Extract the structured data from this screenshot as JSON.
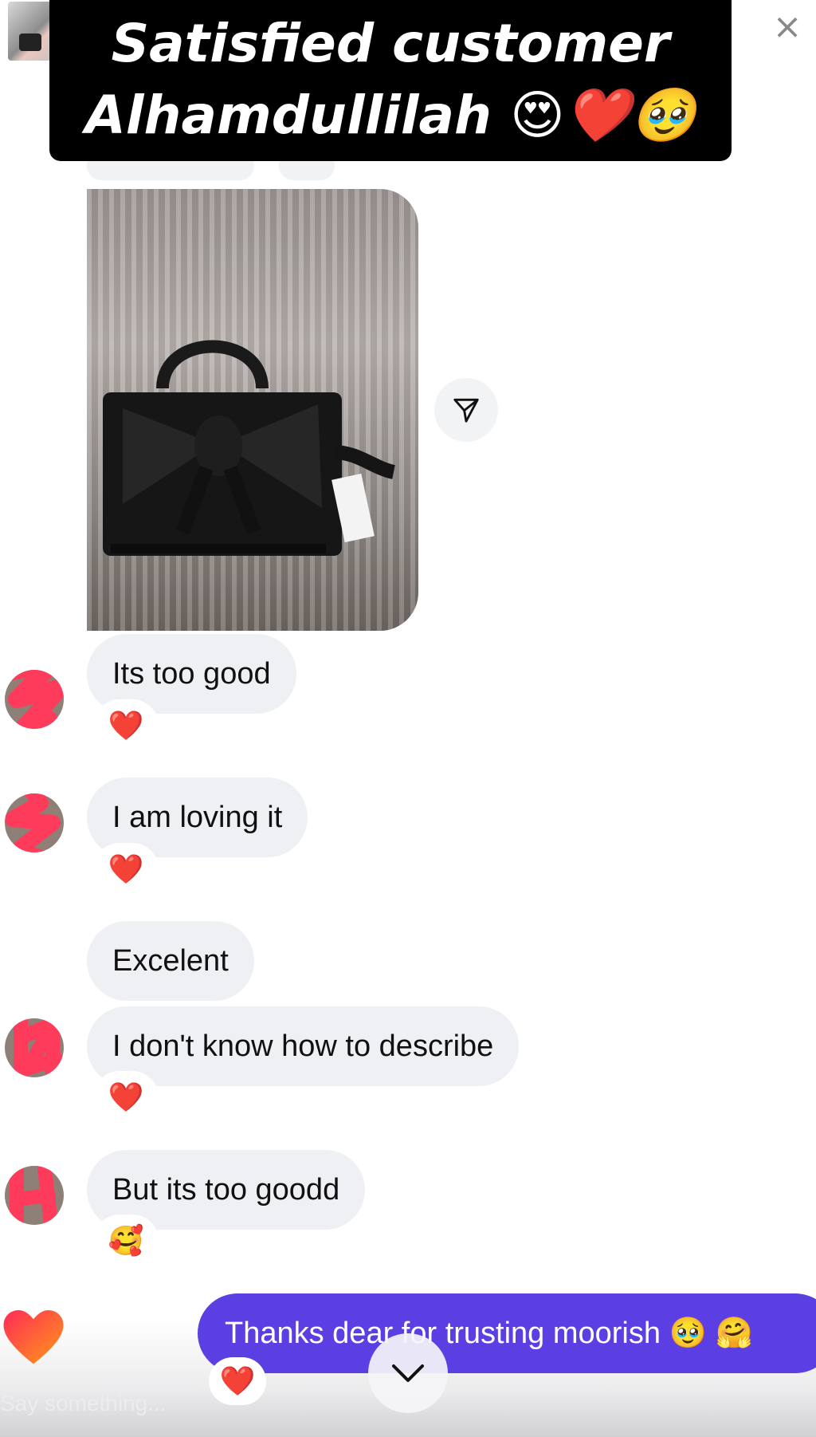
{
  "banner": {
    "line1": "Satisfied customer",
    "line2": "Alhamdullilah 😍❤️🥹"
  },
  "icons": {
    "close": "close-icon",
    "share": "paper-plane-icon",
    "like": "heart-icon",
    "scroll": "chevron-down-icon"
  },
  "messages": [
    {
      "text": "Its too good",
      "reaction": "❤️"
    },
    {
      "text": "I am loving it",
      "reaction": "❤️"
    },
    {
      "text": "Excelent",
      "reaction": ""
    },
    {
      "text": "I don't know how to describe",
      "reaction": "❤️"
    },
    {
      "text": "But its too goodd",
      "reaction": "🥰"
    }
  ],
  "reply": {
    "text": "Thanks dear for trusting moorish 🥹 🤗",
    "reaction": "❤️"
  },
  "composer": {
    "placeholder": "Say something..."
  },
  "colors": {
    "bubble_incoming": "#eff0f3",
    "bubble_outgoing": "#5b3fe3",
    "heart_gradient_start": "#ff2a55",
    "heart_gradient_end": "#ff9b1a",
    "redaction": "#ff3b5c"
  }
}
